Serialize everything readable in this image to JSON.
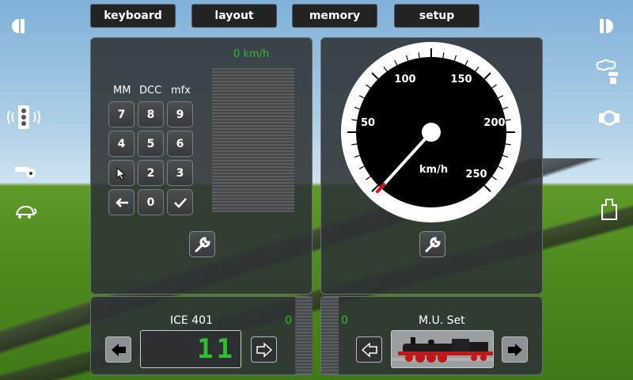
{
  "tabs": [
    {
      "label": "keyboard"
    },
    {
      "label": "layout"
    },
    {
      "label": "memory"
    },
    {
      "label": "setup"
    }
  ],
  "left_icons": [
    "pause-icon",
    "signal-icon",
    "whistle-icon",
    "turtle-icon"
  ],
  "right_icons": [
    "record-icon",
    "smoke-icon",
    "brake-icon",
    "weight-icon"
  ],
  "keypad_panel": {
    "protocols": [
      {
        "label": "MM",
        "selected": true
      },
      {
        "label": "DCC",
        "selected": false
      },
      {
        "label": "mfx",
        "selected": false
      }
    ],
    "speed_readout": "0 km/h",
    "keys": [
      "7",
      "8",
      "9",
      "4",
      "5",
      "6",
      "",
      "2",
      "3",
      "←",
      "0",
      "✓"
    ]
  },
  "speedometer": {
    "labels": [
      "50",
      "100",
      "150",
      "200",
      "250"
    ],
    "unit": "km/h",
    "current_speed": 0,
    "max_speed": 300
  },
  "loco_left": {
    "name": "ICE 401",
    "speed": "0",
    "address_display": "11"
  },
  "loco_right": {
    "name": "M.U. Set",
    "speed": "0"
  },
  "colors": {
    "panel": "#2d3234",
    "accent_green": "#2fbf2f",
    "needle_tip": "#e01010"
  }
}
